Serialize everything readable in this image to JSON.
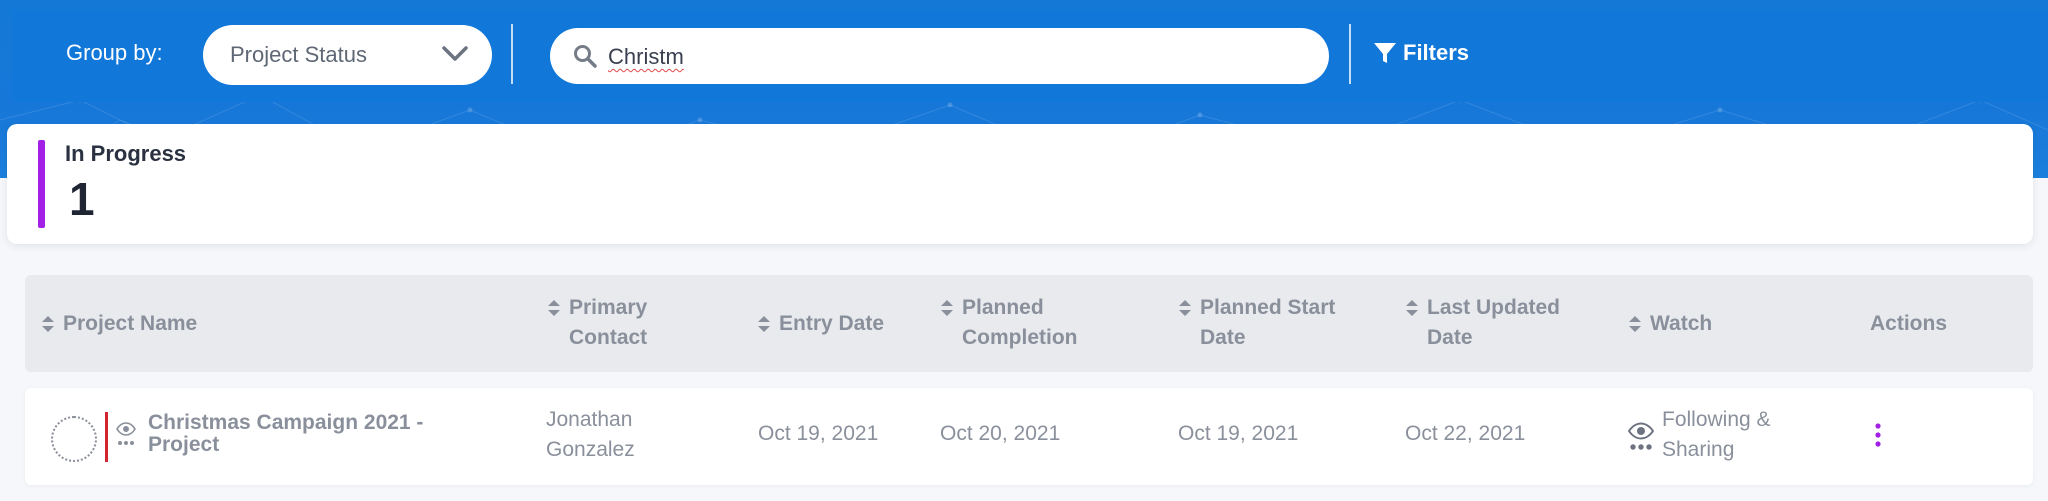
{
  "toolbar": {
    "group_by_label": "Group by:",
    "group_by_value": "Project Status",
    "search_value": "Christm",
    "filters_label": "Filters"
  },
  "summary": {
    "status_label": "In Progress",
    "count": "1",
    "accent_color": "#a321e6"
  },
  "table": {
    "columns": [
      {
        "line1": "Project Name",
        "line2": ""
      },
      {
        "line1": "Primary",
        "line2": "Contact"
      },
      {
        "line1": "Entry Date",
        "line2": ""
      },
      {
        "line1": "Planned",
        "line2": "Completion"
      },
      {
        "line1": "Planned Start",
        "line2": "Date"
      },
      {
        "line1": "Last Updated",
        "line2": "Date"
      },
      {
        "line1": "Watch",
        "line2": ""
      },
      {
        "line1": "Actions",
        "line2": ""
      }
    ],
    "rows": [
      {
        "project_name": "Christmas Campaign 2021 - Project",
        "primary_contact": "Jonathan Gonzalez",
        "entry_date": "Oct 19, 2021",
        "planned_completion": "Oct 20, 2021",
        "planned_start_date": "Oct 19, 2021",
        "last_updated_date": "Oct 22, 2021",
        "watch": "Following & Sharing",
        "status_color": "#d32530"
      }
    ]
  },
  "colors": {
    "brand_blue": "#1177d9",
    "action_purple": "#a321e6"
  }
}
